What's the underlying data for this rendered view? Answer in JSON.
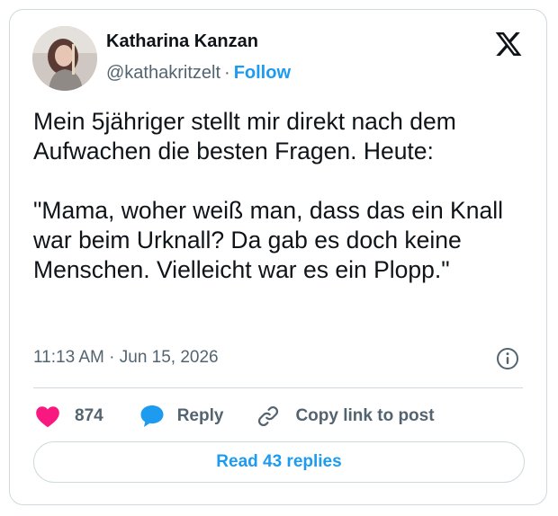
{
  "author": {
    "name": "Katharina Kanzan",
    "handle": "@kathakritzelt",
    "separator": "·",
    "follow_label": "Follow"
  },
  "tweet": {
    "text": "Mein 5jähriger stellt mir direkt nach dem Aufwachen die besten Fragen. Heute:\n\n\"Mama, woher weiß man, dass das ein Knall war beim Urknall? Da gab es doch keine Menschen. Vielleicht war es ein Plopp.\"",
    "timestamp": "11:13 AM · Jun 15, 2026"
  },
  "actions": {
    "like_count": "874",
    "reply_label": "Reply",
    "copy_label": "Copy link to post"
  },
  "read_replies_label": "Read 43 replies",
  "colors": {
    "accent": "#1d9bf0",
    "like": "#f91880",
    "text": "#0f1419",
    "muted": "#536471",
    "border": "#cfd9de"
  },
  "icons": {
    "brand": "x-logo-icon",
    "info": "info-icon",
    "like": "heart-icon",
    "reply": "speech-bubble-icon",
    "copy": "link-icon"
  }
}
